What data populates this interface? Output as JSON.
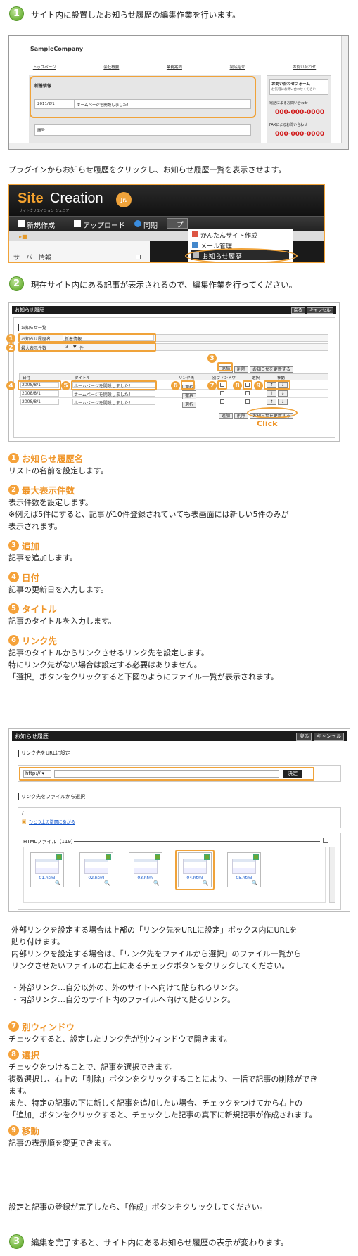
{
  "step1": {
    "num": "1",
    "text": "サイト内に設置したお知らせ履歴の編集作業を行います。"
  },
  "site": {
    "company": "SampleCompany",
    "nav": [
      "トップページ",
      "会社概要",
      "業務案内",
      "製品紹介",
      "お問い合わせ"
    ],
    "news_title": "新着情報",
    "news_date": "2011/2/1",
    "news_text": "ホームページを開設しました！",
    "trade": "商号",
    "contact_title": "お問い合わせフォーム",
    "contact_sub": "お気軽にお問い合わせください",
    "phone_label": "電話によるお問い合わせ",
    "phone": "000-000-0000",
    "fax_label": "FAXによるお問い合わせ",
    "fax": "000-000-0000"
  },
  "instr1": "プラグインからお知らせ履歴をクリックし、お知らせ履歴一覧を表示させます。",
  "app": {
    "logo_site": "Site",
    "logo_creation": "Creation",
    "logo_jr": "Jr.",
    "logo_sub": "サイトクリエイション ジュニア",
    "menu": [
      "新規作成",
      "アップロード",
      "同期",
      "プ"
    ],
    "dd": [
      "かんたんサイト作成",
      "メール管理",
      "お知らせ履歴"
    ],
    "sidebar": "サーバー情報"
  },
  "step2": {
    "num": "2",
    "text": "現在サイト内にある記事が表示されるので、編集作業を行ってください。"
  },
  "editor": {
    "title": "お知らせ履歴",
    "back": "戻る",
    "cancel": "キャンセル",
    "list": "お知らせ一覧",
    "name_label": "お知らせ履歴名",
    "name_value": "新着情報",
    "max_label": "最大表示件数",
    "max_value": "3",
    "max_unit": "件",
    "add": "追加",
    "delete": "削除",
    "update": "お知らせを更新する",
    "cols": [
      "日付",
      "タイトル",
      "リンク先",
      "別ウィンドウ",
      "選択",
      "移動"
    ],
    "rows": [
      {
        "date": "2008/8/1",
        "title": "ホームページを開設しました！"
      },
      {
        "date": "2008/8/1",
        "title": "ホームページを開設しました！"
      },
      {
        "date": "2008/8/1",
        "title": "ホームページを開設しました！"
      }
    ],
    "select": "選択",
    "click": "Click"
  },
  "items": [
    {
      "n": "1",
      "h": "お知らせ履歴名",
      "body": [
        "リストの名前を設定します。"
      ]
    },
    {
      "n": "2",
      "h": "最大表示件数",
      "body": [
        "表示件数を設定します。",
        "※例えば5件にすると、記事が10件登録されていても表画面には新しい5件のみが",
        "表示されます。"
      ]
    },
    {
      "n": "3",
      "h": "追加",
      "body": [
        "記事を追加します。"
      ]
    },
    {
      "n": "4",
      "h": "日付",
      "body": [
        "記事の更新日を入力します。"
      ]
    },
    {
      "n": "5",
      "h": "タイトル",
      "body": [
        "記事のタイトルを入力します。"
      ]
    },
    {
      "n": "6",
      "h": "リンク先",
      "body": [
        "記事のタイトルからリンクさせるリンク先を設定します。",
        "特にリンク先がない場合は設定する必要はありません。",
        "「選択」ボタンをクリックすると下図のようにファイル一覧が表示されます。"
      ]
    }
  ],
  "link": {
    "title": "お知らせ履歴",
    "back": "戻る",
    "cancel": "キャンセル",
    "url_section": "リンク先をURLに設定",
    "proto": "http://",
    "decide": "決定",
    "file_section": "リンク先をファイルから選択",
    "root": "/",
    "up": "ひとつ上の階層にあがる",
    "files_header": "HTMLファイル（119）",
    "files": [
      "01.html",
      "02.html",
      "03.html",
      "04.html",
      "05.html"
    ]
  },
  "explain": [
    "外部リンクを設定する場合は上部の「リンク先をURLに設定」ボックス内にURLを",
    "貼り付けます。",
    "内部リンクを設定する場合は、「リンク先をファイルから選択」のファイル一覧から",
    "リンクさせたいファイルの右上にあるチェックボタンをクリックしてください。"
  ],
  "bullets": [
    "・外部リンク…自分以外の、外のサイトへ向けて貼られるリンク。",
    "・内部リンク…自分のサイト内のファイルへ向けて貼るリンク。"
  ],
  "items2": [
    {
      "n": "7",
      "h": "別ウィンドウ",
      "body": [
        "チェックすると、設定したリンク先が別ウィンドウで開きます。"
      ]
    },
    {
      "n": "8",
      "h": "選択",
      "body": [
        "チェックをつけることで、記事を選択できます。",
        "複数選択し、右上の「削除」ボタンをクリックすることにより、一括で記事の削除ができ",
        "ます。",
        "また、特定の記事の下に新しく記事を追加したい場合、チェックをつけてから右上の",
        "「追加」ボタンをクリックすると、チェックした記事の真下に新規記事が作成されます。"
      ]
    },
    {
      "n": "9",
      "h": "移動",
      "body": [
        "記事の表示順を変更できます。"
      ]
    }
  ],
  "finish": "設定と記事の登録が完了したら、「作成」ボタンをクリックしてください。",
  "step3": {
    "num": "3",
    "text": "編集を完了すると、サイト内にあるお知らせ履歴の表示が変わります。"
  }
}
